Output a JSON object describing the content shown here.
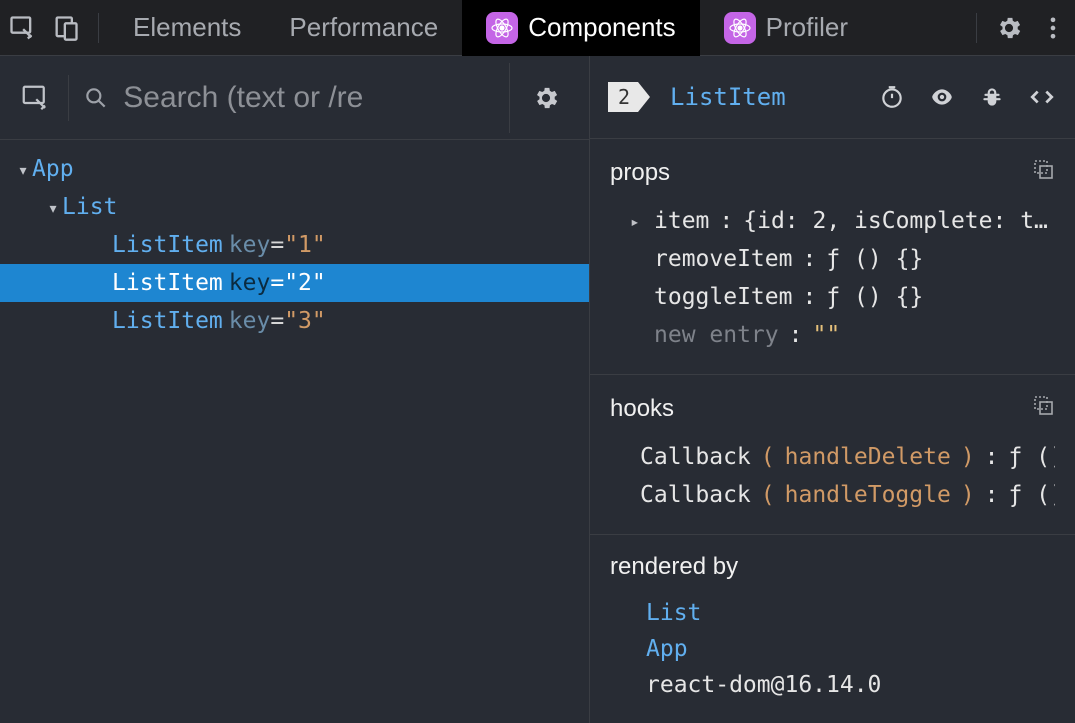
{
  "tabbar": {
    "tabs": [
      {
        "label": "Elements",
        "active": false,
        "react": false
      },
      {
        "label": "Performance",
        "active": false,
        "react": false
      },
      {
        "label": "Components",
        "active": true,
        "react": true
      },
      {
        "label": "Profiler",
        "active": false,
        "react": true
      }
    ]
  },
  "search": {
    "placeholder": "Search (text or /re"
  },
  "tree": {
    "nodes": [
      {
        "name": "App",
        "depth": 0,
        "expandable": true,
        "selected": false,
        "key": null
      },
      {
        "name": "List",
        "depth": 1,
        "expandable": true,
        "selected": false,
        "key": null
      },
      {
        "name": "ListItem",
        "depth": 2,
        "expandable": false,
        "selected": false,
        "key": "1"
      },
      {
        "name": "ListItem",
        "depth": 2,
        "expandable": false,
        "selected": true,
        "key": "2"
      },
      {
        "name": "ListItem",
        "depth": 2,
        "expandable": false,
        "selected": false,
        "key": "3"
      }
    ]
  },
  "detail": {
    "badge": "2",
    "component": "ListItem",
    "sections": {
      "props": {
        "title": "props",
        "entries": [
          {
            "key": "item",
            "value": "{id: 2, isComplete: t…",
            "expandable": true
          },
          {
            "key": "removeItem",
            "value": "ƒ () {}",
            "expandable": false
          },
          {
            "key": "toggleItem",
            "value": "ƒ () {}",
            "expandable": false
          }
        ],
        "new_entry_label": "new entry",
        "new_entry_value": "\"\""
      },
      "hooks": {
        "title": "hooks",
        "entries": [
          {
            "kind": "Callback",
            "name": "handleDelete",
            "value": "ƒ () {}"
          },
          {
            "kind": "Callback",
            "name": "handleToggle",
            "value": "ƒ () {}"
          }
        ]
      },
      "rendered_by": {
        "title": "rendered by",
        "items": [
          "List",
          "App",
          "react-dom@16.14.0"
        ]
      }
    }
  }
}
